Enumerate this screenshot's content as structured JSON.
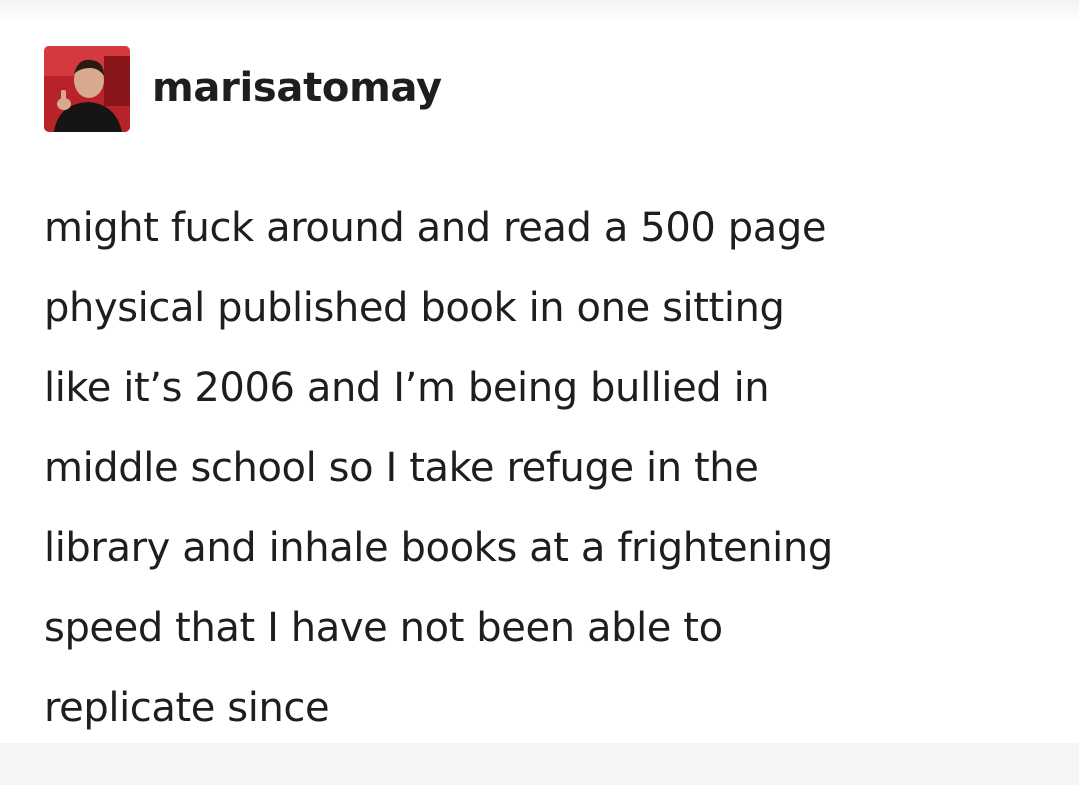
{
  "post": {
    "username": "marisatomay",
    "lines": [
      "might fuck around and read a 500 page",
      "physical published book in one sitting",
      "like it’s 2006 and I’m being bullied in",
      "middle school so I take refuge in the",
      "library and inhale books at a frightening",
      "speed that I have not been able to",
      "replicate since"
    ]
  },
  "avatar": {
    "icon": "user-photo-avatar"
  },
  "colors": {
    "text": "#1e1e1e",
    "avatar_bg": "#b8232a"
  }
}
